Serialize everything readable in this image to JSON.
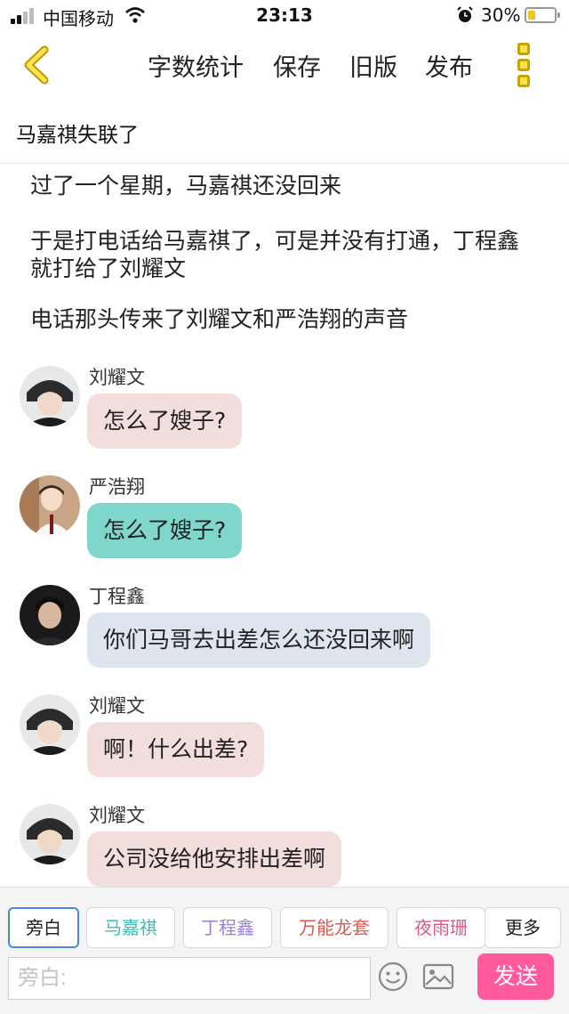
{
  "status_bar": {
    "carrier": "中国移动",
    "time": "23:13",
    "battery": "30%",
    "battery_level": 0.3
  },
  "toolbar": {
    "word_count": "字数统计",
    "save": "保存",
    "old_version": "旧版",
    "publish": "发布"
  },
  "story_title": "马嘉祺失联了",
  "narration": [
    "过了一个星期，马嘉祺还没回来",
    "于是打电话给马嘉祺了，可是并没有打通，丁程鑫就打给了刘耀文",
    "电话那头传来了刘耀文和严浩翔的声音"
  ],
  "messages": [
    {
      "name": "刘耀文",
      "text": "怎么了嫂子?",
      "bubble_color": "#f2dedd"
    },
    {
      "name": "严浩翔",
      "text": "怎么了嫂子?",
      "bubble_color": "#7fd7cc"
    },
    {
      "name": "丁程鑫",
      "text": "你们马哥去出差怎么还没回来啊",
      "bubble_color": "#dfe5ee"
    },
    {
      "name": "刘耀文",
      "text": "啊！什么出差?",
      "bubble_color": "#f2dedd"
    },
    {
      "name": "刘耀文",
      "text": "公司没给他安排出差啊",
      "bubble_color": "#f2dedd"
    }
  ],
  "characters": [
    {
      "label": "旁白",
      "color": "#222222"
    },
    {
      "label": "马嘉祺",
      "color": "#3cc0b0"
    },
    {
      "label": "丁程鑫",
      "color": "#9a7fd6"
    },
    {
      "label": "万能龙套",
      "color": "#e0584f"
    },
    {
      "label": "夜雨珊",
      "color": "#e0588f"
    },
    {
      "label": "更多",
      "color": "#222222"
    }
  ],
  "input": {
    "placeholder": "旁白:"
  },
  "send_label": "发送",
  "colors": {
    "accent_yellow": "#ffe04d",
    "send_pink": "#ff5b9c",
    "active_chip_border": "#4a86e8"
  }
}
